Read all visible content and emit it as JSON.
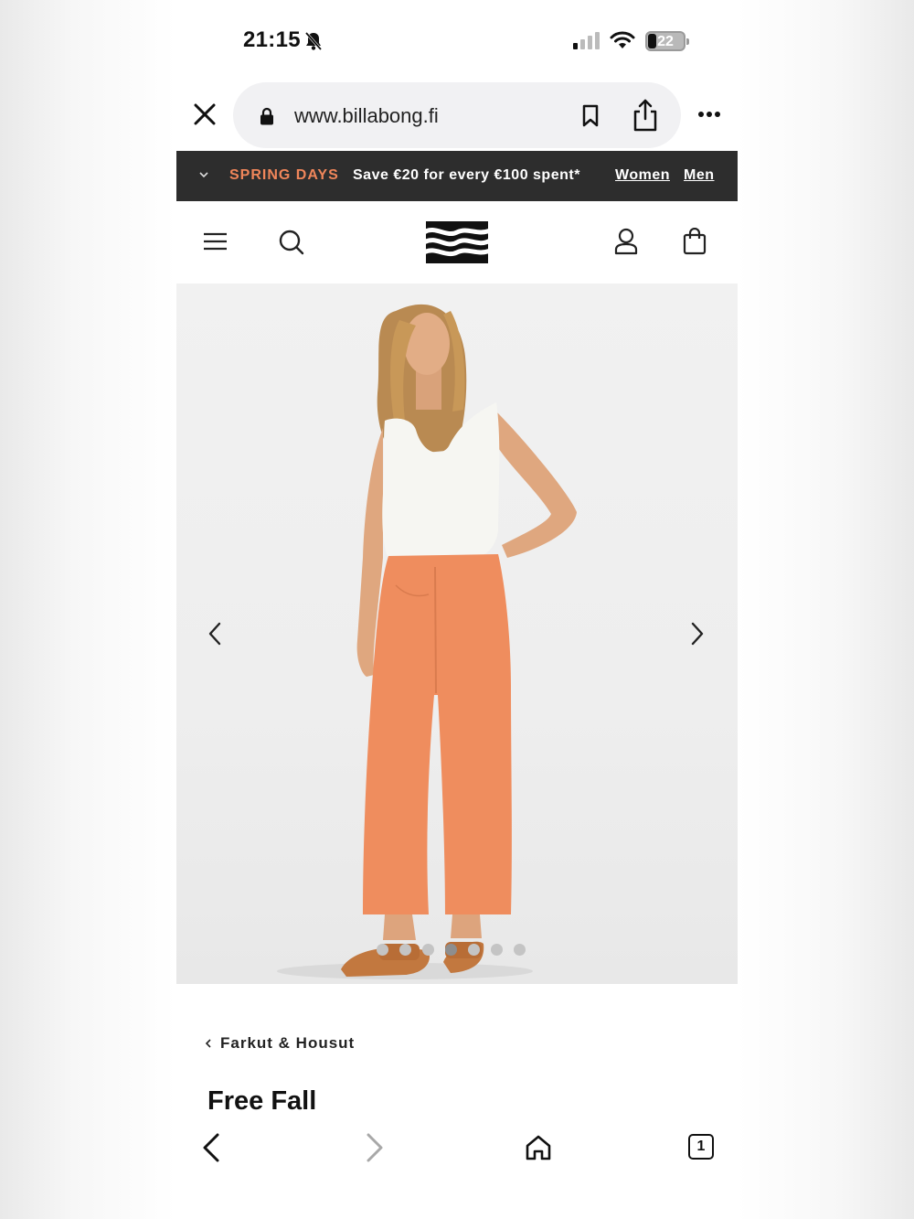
{
  "status_bar": {
    "time": "21:15",
    "battery_percent": "22",
    "icons": [
      "silent-bell-icon",
      "cellular-signal-icon",
      "wifi-icon",
      "battery-icon"
    ]
  },
  "browser": {
    "url": "www.billabong.fi",
    "icons": [
      "close-icon",
      "lock-icon",
      "bookmark-icon",
      "share-icon",
      "more-icon"
    ]
  },
  "promo": {
    "tag": "SPRING DAYS",
    "message": "Save €20 for every €100 spent*",
    "links": [
      "Women",
      "Men"
    ],
    "tag_color": "#f0865a"
  },
  "header": {
    "icons": [
      "menu-icon",
      "search-icon",
      "billabong-logo",
      "account-icon",
      "shopping-bag-icon"
    ]
  },
  "gallery": {
    "image_description": "product-photo",
    "slide_count": 7,
    "active_slide": 4
  },
  "product": {
    "breadcrumb": "Farkut & Housut",
    "title": "Free Fall"
  },
  "toolbar": {
    "tabs_count": "1",
    "icons": [
      "back-icon",
      "forward-icon",
      "home-icon",
      "tabs-icon"
    ]
  }
}
